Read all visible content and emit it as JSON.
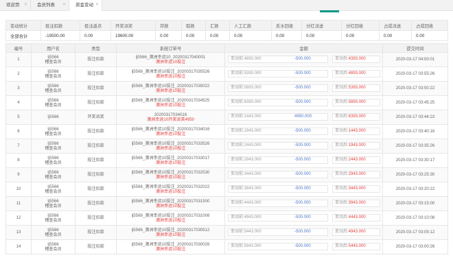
{
  "tabs": [
    {
      "label": "欢迎页"
    },
    {
      "label": "会员列表"
    },
    {
      "label": "资金变动"
    }
  ],
  "summary": {
    "headers": [
      "变动统计",
      "投注扣款",
      "投注返点",
      "开奖派奖",
      "存款",
      "取款",
      "汇款",
      "人工汇款",
      "反水回收",
      "分红派送",
      "分红回收",
      "占成派送",
      "占成回收"
    ],
    "values": [
      "全部合计",
      "-19500.00",
      "0.00",
      "19600.00",
      "0.00",
      "0.00",
      "0.00",
      "0.00",
      "0.00",
      "0.00",
      "0.00",
      "0.00",
      "0.00"
    ]
  },
  "columns": [
    "编号",
    "用户名",
    "类型",
    "系统订单号",
    "金额",
    "提交时间"
  ],
  "rows": [
    {
      "id": "1",
      "user": "lj5566",
      "role": "稽查会员",
      "type": "投注扣款",
      "order": "lj5566_澳洲幸运10_20200317040001",
      "note": "澳洲幸运10投注",
      "before_label": "变动前:",
      "before": "4893.000",
      "amount": "-500.000",
      "after_label": "变动后:",
      "after": "4393.000",
      "time": "2020-03-17 04:00:01"
    },
    {
      "id": "2",
      "user": "lj5566",
      "role": "稽查会员",
      "type": "投注扣款",
      "order": "lj5566_澳洲幸运10投注_20200317035526",
      "note": "澳洲幸运10投注",
      "before_label": "变动前:",
      "before": "5393.000",
      "amount": "-500.000",
      "after_label": "变动后:",
      "after": "4893.000",
      "time": "2020-03-17 03:55:26"
    },
    {
      "id": "3",
      "user": "lj5566",
      "role": "稽查会员",
      "type": "投注扣款",
      "order": "lj5566_澳洲幸运10投注_20200317035022",
      "note": "澳洲幸运10投注",
      "before_label": "变动前:",
      "before": "5893.000",
      "amount": "-500.000",
      "after_label": "变动后:",
      "after": "5393.000",
      "time": "2020-03-17 03:50:22"
    },
    {
      "id": "4",
      "user": "lj5566",
      "role": "稽查会员",
      "type": "投注扣款",
      "order": "lj5566_澳洲幸运10投注_20200317034525",
      "note": "澳洲幸运10投注",
      "before_label": "变动前:",
      "before": "6393.000",
      "amount": "-500.000",
      "after_label": "变动后:",
      "after": "5893.000",
      "time": "2020-03-17 03:45:25"
    },
    {
      "id": "5",
      "user": "lj5566",
      "role": "",
      "type": "开奖派奖",
      "order": "20200317034016",
      "note": "澳洲幸运10开奖派奖4950",
      "before_label": "变动前:",
      "before": "1443.000",
      "amount": "4950.000",
      "after_label": "变动后:",
      "after": "6393.000",
      "time": "2020-03-17 03:44:23"
    },
    {
      "id": "6",
      "user": "lj5566",
      "role": "稽查会员",
      "type": "投注扣款",
      "order": "lj5566_澳洲幸运10投注_20200317034016",
      "note": "澳洲幸运10投注",
      "before_label": "变动前:",
      "before": "1943.000",
      "amount": "-500.000",
      "after_label": "变动后:",
      "after": "1443.000",
      "time": "2020-03-17 03:40:16"
    },
    {
      "id": "7",
      "user": "lj5566",
      "role": "稽查会员",
      "type": "投注扣款",
      "order": "lj5566_澳洲幸运10投注_20200317033526",
      "note": "澳洲幸运10投注",
      "before_label": "变动前:",
      "before": "2443.000",
      "amount": "-500.000",
      "after_label": "变动后:",
      "after": "1943.000",
      "time": "2020-03-17 03:35:26"
    },
    {
      "id": "8",
      "user": "lj5566",
      "role": "稽查会员",
      "type": "投注扣款",
      "order": "lj5566_澳洲幸运10投注_20200317033017",
      "note": "澳洲幸运10投注",
      "before_label": "变动前:",
      "before": "2943.000",
      "amount": "-500.000",
      "after_label": "变动后:",
      "after": "2443.000",
      "time": "2020-03-17 03:30:17"
    },
    {
      "id": "9",
      "user": "lj5566",
      "role": "稽查会员",
      "type": "投注扣款",
      "order": "lj5566_澳洲幸运10投注_20200317032530",
      "note": "澳洲幸运10投注",
      "before_label": "变动前:",
      "before": "3443.000",
      "amount": "-500.000",
      "after_label": "变动后:",
      "after": "2943.000",
      "time": "2020-03-17 03:25:30"
    },
    {
      "id": "10",
      "user": "lj5566",
      "role": "稽查会员",
      "type": "投注扣款",
      "order": "lj5566_澳洲幸运10投注_20200317032022",
      "note": "澳洲幸运10投注",
      "before_label": "变动前:",
      "before": "3943.000",
      "amount": "-500.000",
      "after_label": "变动后:",
      "after": "3443.000",
      "time": "2020-03-17 03:20:22"
    },
    {
      "id": "11",
      "user": "lj5566",
      "role": "稽查会员",
      "type": "投注扣款",
      "order": "lj5566_澳洲幸运10投注_20200317031500",
      "note": "澳洲幸运10投注",
      "before_label": "变动前:",
      "before": "4443.000",
      "amount": "-500.000",
      "after_label": "变动后:",
      "after": "3943.000",
      "time": "2020-03-17 03:15:00"
    },
    {
      "id": "12",
      "user": "lj5566",
      "role": "稽查会员",
      "type": "投注扣款",
      "order": "lj5566_澳洲幸运10投注_20200317031008",
      "note": "澳洲幸运10投注",
      "before_label": "变动前:",
      "before": "4943.000",
      "amount": "-500.000",
      "after_label": "变动后:",
      "after": "4443.000",
      "time": "2020-03-17 03:10:08"
    },
    {
      "id": "13",
      "user": "lj5566",
      "role": "稽查会员",
      "type": "投注扣款",
      "order": "lj5566_澳洲幸运10投注_20200317030512",
      "note": "澳洲幸运10投注",
      "before_label": "变动前:",
      "before": "5443.000",
      "amount": "-500.000",
      "after_label": "变动后:",
      "after": "4943.000",
      "time": "2020-03-17 03:05:12"
    },
    {
      "id": "14",
      "user": "lj5566",
      "role": "稽查会员",
      "type": "投注扣款",
      "order": "lj5566_澳洲幸运10投注_20200317030026",
      "note": "澳洲幸运10投注",
      "before_label": "变动前:",
      "before": "5943.000",
      "amount": "-500.000",
      "after_label": "变动后:",
      "after": "5443.000",
      "time": "2020-03-17 03:00:26"
    }
  ]
}
